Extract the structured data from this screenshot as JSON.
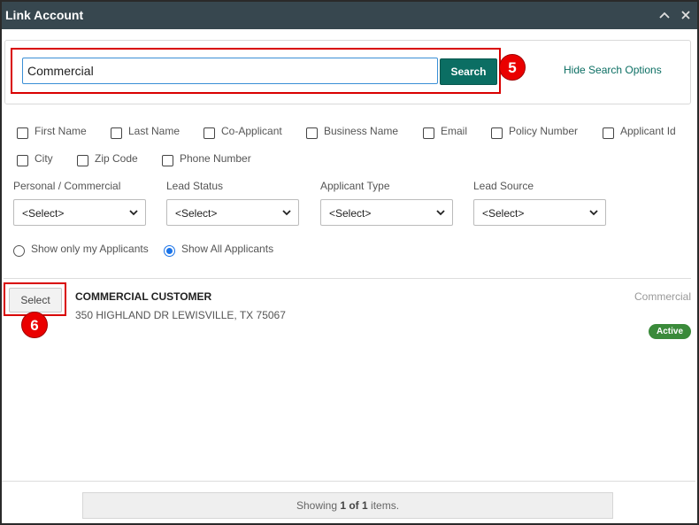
{
  "window": {
    "title": "Link Account"
  },
  "search": {
    "value": "Commercial",
    "button_label": "Search",
    "hide_options_label": "Hide Search Options"
  },
  "checkboxes": [
    {
      "label": "First Name",
      "checked": false
    },
    {
      "label": "Last Name",
      "checked": false
    },
    {
      "label": "Co-Applicant",
      "checked": false
    },
    {
      "label": "Business Name",
      "checked": false
    },
    {
      "label": "Email",
      "checked": false
    },
    {
      "label": "Policy Number",
      "checked": false
    },
    {
      "label": "Applicant Id",
      "checked": false
    },
    {
      "label": "City",
      "checked": false
    },
    {
      "label": "Zip Code",
      "checked": false
    },
    {
      "label": "Phone Number",
      "checked": false
    }
  ],
  "filters": [
    {
      "label": "Personal / Commercial",
      "selected": "<Select>"
    },
    {
      "label": "Lead Status",
      "selected": "<Select>"
    },
    {
      "label": "Applicant Type",
      "selected": "<Select>"
    },
    {
      "label": "Lead Source",
      "selected": "<Select>"
    }
  ],
  "radios": [
    {
      "label": "Show only my Applicants",
      "checked": false
    },
    {
      "label": "Show All Applicants",
      "checked": true
    }
  ],
  "results": [
    {
      "select_label": "Select",
      "name": "COMMERCIAL CUSTOMER",
      "address": "350 HIGHLAND DR LEWISVILLE, TX 75067",
      "type": "Commercial",
      "status": "Active"
    }
  ],
  "pager": {
    "prefix": "Showing ",
    "range": "1 of 1",
    "suffix": " items."
  },
  "annotations": {
    "step_5": "5",
    "step_6": "6"
  },
  "colors": {
    "titlebar": "#37474f",
    "accent": "#0b6e63",
    "callout": "#d90000",
    "active_badge": "#3a8a3a",
    "radio_selected": "#1a73e8"
  }
}
